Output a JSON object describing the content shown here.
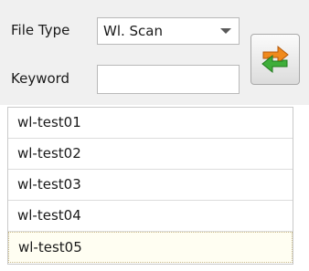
{
  "filters": {
    "file_type_label": "File Type",
    "file_type_value": "Wl. Scan",
    "keyword_label": "Keyword",
    "keyword_value": "",
    "refresh_icon": "refresh-arrows-icon"
  },
  "list": {
    "items": [
      {
        "label": "wl-test01"
      },
      {
        "label": "wl-test02"
      },
      {
        "label": "wl-test03"
      },
      {
        "label": "wl-test04"
      },
      {
        "label": "wl-test05",
        "focused": true
      }
    ]
  },
  "colors": {
    "toolbar_bg": "#f0f0f0",
    "icon_orange": "#f08a1c",
    "icon_green": "#3fae3a"
  }
}
